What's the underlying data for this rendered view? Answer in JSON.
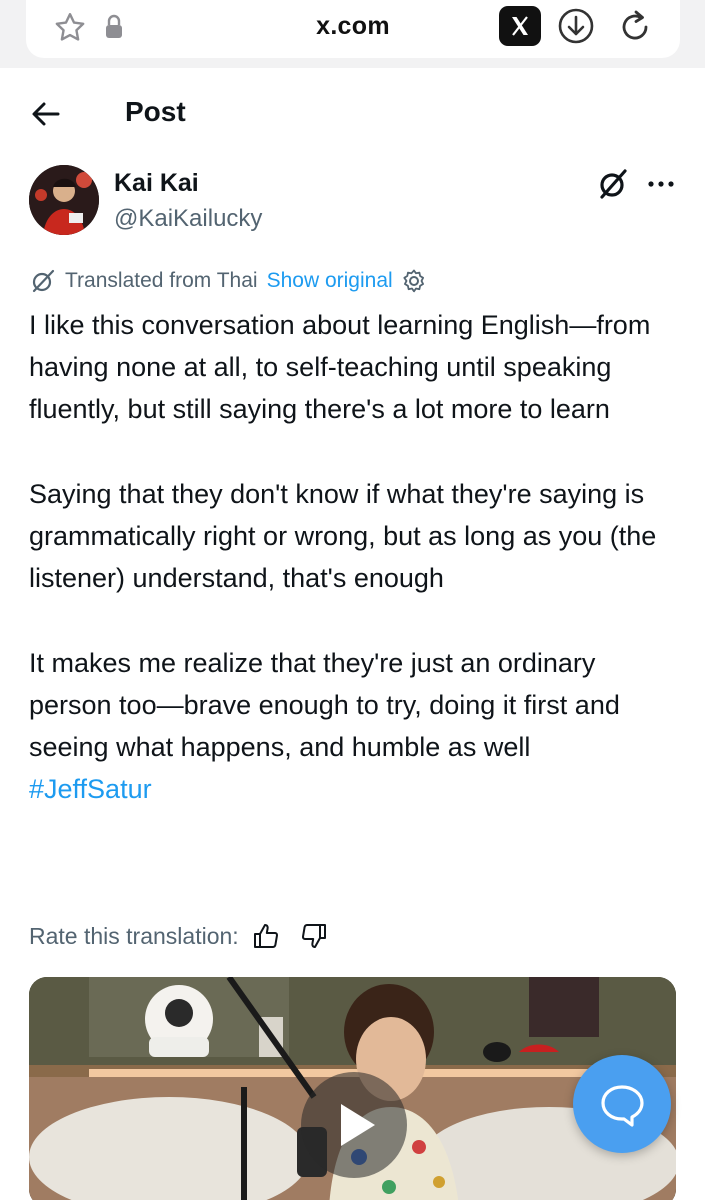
{
  "browser": {
    "url": "x.com",
    "icons": [
      "star-icon",
      "lock-icon",
      "x-logo-icon",
      "download-icon",
      "reload-icon"
    ]
  },
  "header": {
    "title": "Post",
    "back_icon": "arrow-left-icon"
  },
  "post": {
    "author": {
      "display_name": "Kai Kai",
      "handle": "@KaiKailucky"
    },
    "translation": {
      "label": "Translated from Thai",
      "show_original": "Show original"
    },
    "paragraphs": [
      "I like this conversation about learning English—from having none at all, to self-teaching until speaking fluently, but still saying there's a lot more to learn",
      "Saying that they don't know if what they're saying is grammatically right or wrong, but as long as you (the listener) understand, that's enough",
      "It makes me realize that they're just an ordinary person too—brave enough to try, doing it first and seeing what happens, and humble as well"
    ],
    "hashtag": "#JeffSatur",
    "rate_translation": "Rate this translation:"
  },
  "colors": {
    "accent": "#1d9bf0",
    "text": "#0f1419",
    "muted": "#536471",
    "fab": "#4a9ff0"
  }
}
